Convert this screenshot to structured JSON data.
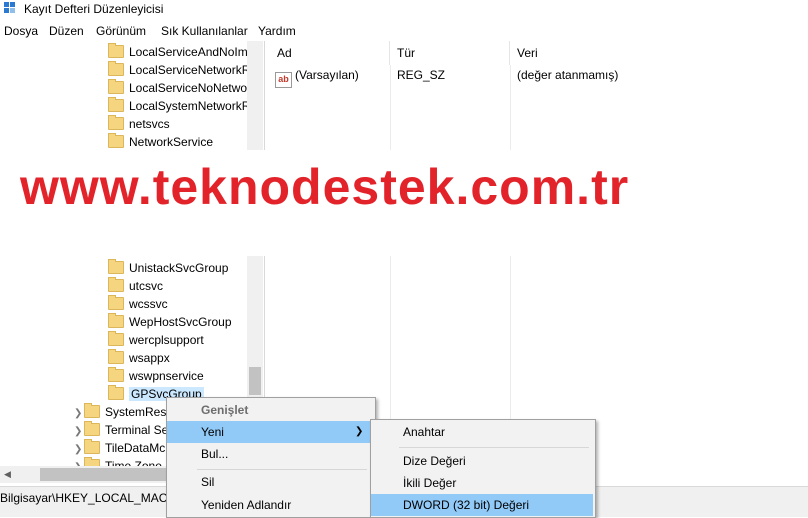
{
  "window": {
    "title": "Kayıt Defteri Düzenleyicisi"
  },
  "menu": [
    "Dosya",
    "Düzen",
    "Görünüm",
    "Sık Kullanılanlar",
    "Yardım"
  ],
  "tree": {
    "upper_items": [
      "LocalServiceAndNoIm",
      "LocalServiceNetworkR",
      "LocalServiceNoNetwor",
      "LocalSystemNetworkR",
      "netsvcs",
      "NetworkService"
    ],
    "lower_items": [
      "UnistackSvcGroup",
      "utcsvc",
      "wcssvc",
      "WepHostSvcGroup",
      "wercplsupport",
      "wsappx",
      "wswpnservice"
    ],
    "selected_item": "GPSvcGroup",
    "parent_items": [
      "SystemRes",
      "Terminal Se",
      "TileDataMc",
      "Time Zone"
    ]
  },
  "list": {
    "columns": [
      "Ad",
      "Tür",
      "Veri"
    ],
    "rows": [
      {
        "name": "(Varsayılan)",
        "type": "REG_SZ",
        "data": "(değer atanmamış)",
        "icon": "ab"
      }
    ]
  },
  "status_path": "Bilgisayar\\HKEY_LOCAL_MACH",
  "watermark": "www.teknodestek.com.tr",
  "context_menu": {
    "items": [
      "Genişlet",
      "Yeni",
      "Bul...",
      "Sil",
      "Yeniden Adlandır"
    ],
    "disabled": "Genişlet",
    "highlighted": "Yeni"
  },
  "submenu": {
    "items": [
      "Anahtar",
      "Dize Değeri",
      "İkili Değer",
      "DWORD (32 bit) Değeri"
    ],
    "highlighted": "DWORD (32 bit) Değeri"
  },
  "colors": {
    "watermark": "#e3232a",
    "highlight": "#91c9f7",
    "selection": "#cce8ff"
  }
}
